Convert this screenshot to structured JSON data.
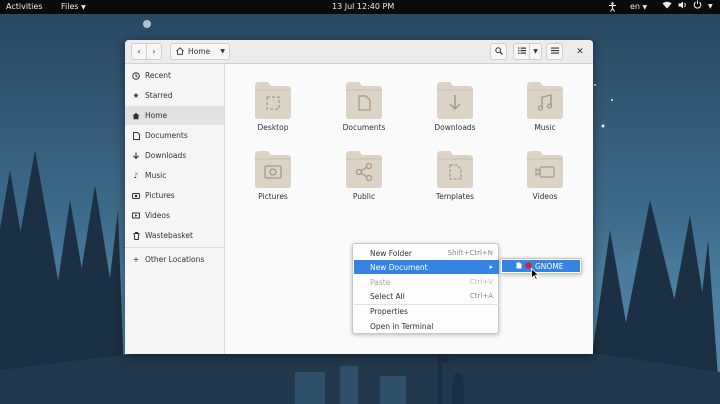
{
  "colors": {
    "sky_top": "#26465f",
    "sky_bottom": "#6a9fbf",
    "tree_dark": "#1b3042",
    "accent": "#3584e4",
    "folder": "#dcd3c7",
    "folder_glyph": "#a89986"
  },
  "topbar": {
    "activities": "Activities",
    "app_menu": "Files",
    "clock": "13 Jul  12:40 PM",
    "language": "en",
    "icons": [
      "accessibility-icon",
      "network-icon",
      "volume-icon",
      "power-icon",
      "chevron-down-icon"
    ]
  },
  "window": {
    "path_label": "Home",
    "header_icons": [
      "back-icon",
      "forward-icon",
      "home-icon",
      "search-icon",
      "view-list-icon",
      "menu-icon",
      "close-icon"
    ]
  },
  "sidebar": {
    "items": [
      {
        "label": "Recent",
        "icon": "clock-icon"
      },
      {
        "label": "Starred",
        "icon": "star-icon"
      },
      {
        "label": "Home",
        "icon": "home-icon",
        "active": true
      },
      {
        "label": "Documents",
        "icon": "document-icon"
      },
      {
        "label": "Downloads",
        "icon": "download-icon"
      },
      {
        "label": "Music",
        "icon": "music-icon"
      },
      {
        "label": "Pictures",
        "icon": "camera-icon"
      },
      {
        "label": "Videos",
        "icon": "video-icon"
      },
      {
        "label": "Wastebasket",
        "icon": "trash-icon"
      }
    ],
    "other": {
      "label": "Other Locations",
      "icon": "plus-icon"
    }
  },
  "folders": [
    {
      "label": "Desktop",
      "icon": "desktop-glyph"
    },
    {
      "label": "Documents",
      "icon": "document-glyph"
    },
    {
      "label": "Downloads",
      "icon": "download-glyph"
    },
    {
      "label": "Music",
      "icon": "music-glyph"
    },
    {
      "label": "Pictures",
      "icon": "camera-glyph"
    },
    {
      "label": "Public",
      "icon": "share-glyph"
    },
    {
      "label": "Templates",
      "icon": "template-glyph"
    },
    {
      "label": "Videos",
      "icon": "video-glyph"
    }
  ],
  "context_menu": {
    "items": [
      {
        "label": "New Folder",
        "accel": "Shift+Ctrl+N"
      },
      {
        "label": "New Document",
        "accel": "▸",
        "highlighted": true
      },
      {
        "label": "Paste",
        "accel": "Ctrl+V",
        "disabled": true
      },
      {
        "label": "Select All",
        "accel": "Ctrl+A"
      },
      {
        "label": "Properties",
        "accel": ""
      },
      {
        "label": "Open in Terminal",
        "accel": ""
      }
    ],
    "submenu": {
      "label": "GNOME"
    }
  }
}
